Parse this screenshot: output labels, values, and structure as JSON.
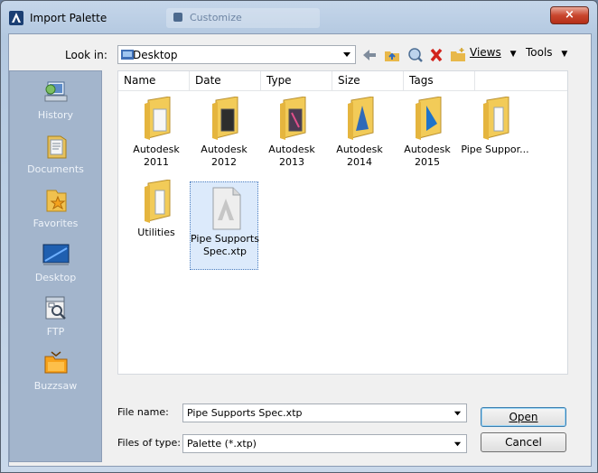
{
  "window": {
    "title": "Import Palette",
    "background_tab": "Customize",
    "close_glyph": "×"
  },
  "toolbar": {
    "look_in_label": "Look in:",
    "look_in_value": "Desktop",
    "views_label": "Views",
    "tools_label": "Tools"
  },
  "places": [
    {
      "label": "History",
      "icon": "history-icon"
    },
    {
      "label": "Documents",
      "icon": "documents-icon"
    },
    {
      "label": "Favorites",
      "icon": "favorites-icon"
    },
    {
      "label": "Desktop",
      "icon": "desktop-icon"
    },
    {
      "label": "FTP",
      "icon": "ftp-icon"
    },
    {
      "label": "Buzzsaw",
      "icon": "buzzsaw-icon"
    }
  ],
  "columns": [
    "Name",
    "Date",
    "Type",
    "Size",
    "Tags"
  ],
  "files": [
    {
      "label": "Autodesk 2011",
      "icon": "folder-icon"
    },
    {
      "label": "Autodesk 2012",
      "icon": "folder-icon"
    },
    {
      "label": "Autodesk 2013",
      "icon": "folder-icon"
    },
    {
      "label": "Autodesk 2014",
      "icon": "folder-icon"
    },
    {
      "label": "Autodesk 2015",
      "icon": "folder-icon"
    },
    {
      "label": "Pipe Suppor...",
      "icon": "folder-icon"
    },
    {
      "label": "Utilities",
      "icon": "folder-icon"
    },
    {
      "label": "Pipe Supports Spec.xtp",
      "icon": "autodesk-file-icon",
      "selected": true
    }
  ],
  "file_name": {
    "label": "File name:",
    "value": "Pipe Supports Spec.xtp"
  },
  "file_type": {
    "label": "Files of type:",
    "value": "Palette (*.xtp)"
  },
  "buttons": {
    "open": "Open",
    "cancel": "Cancel"
  }
}
